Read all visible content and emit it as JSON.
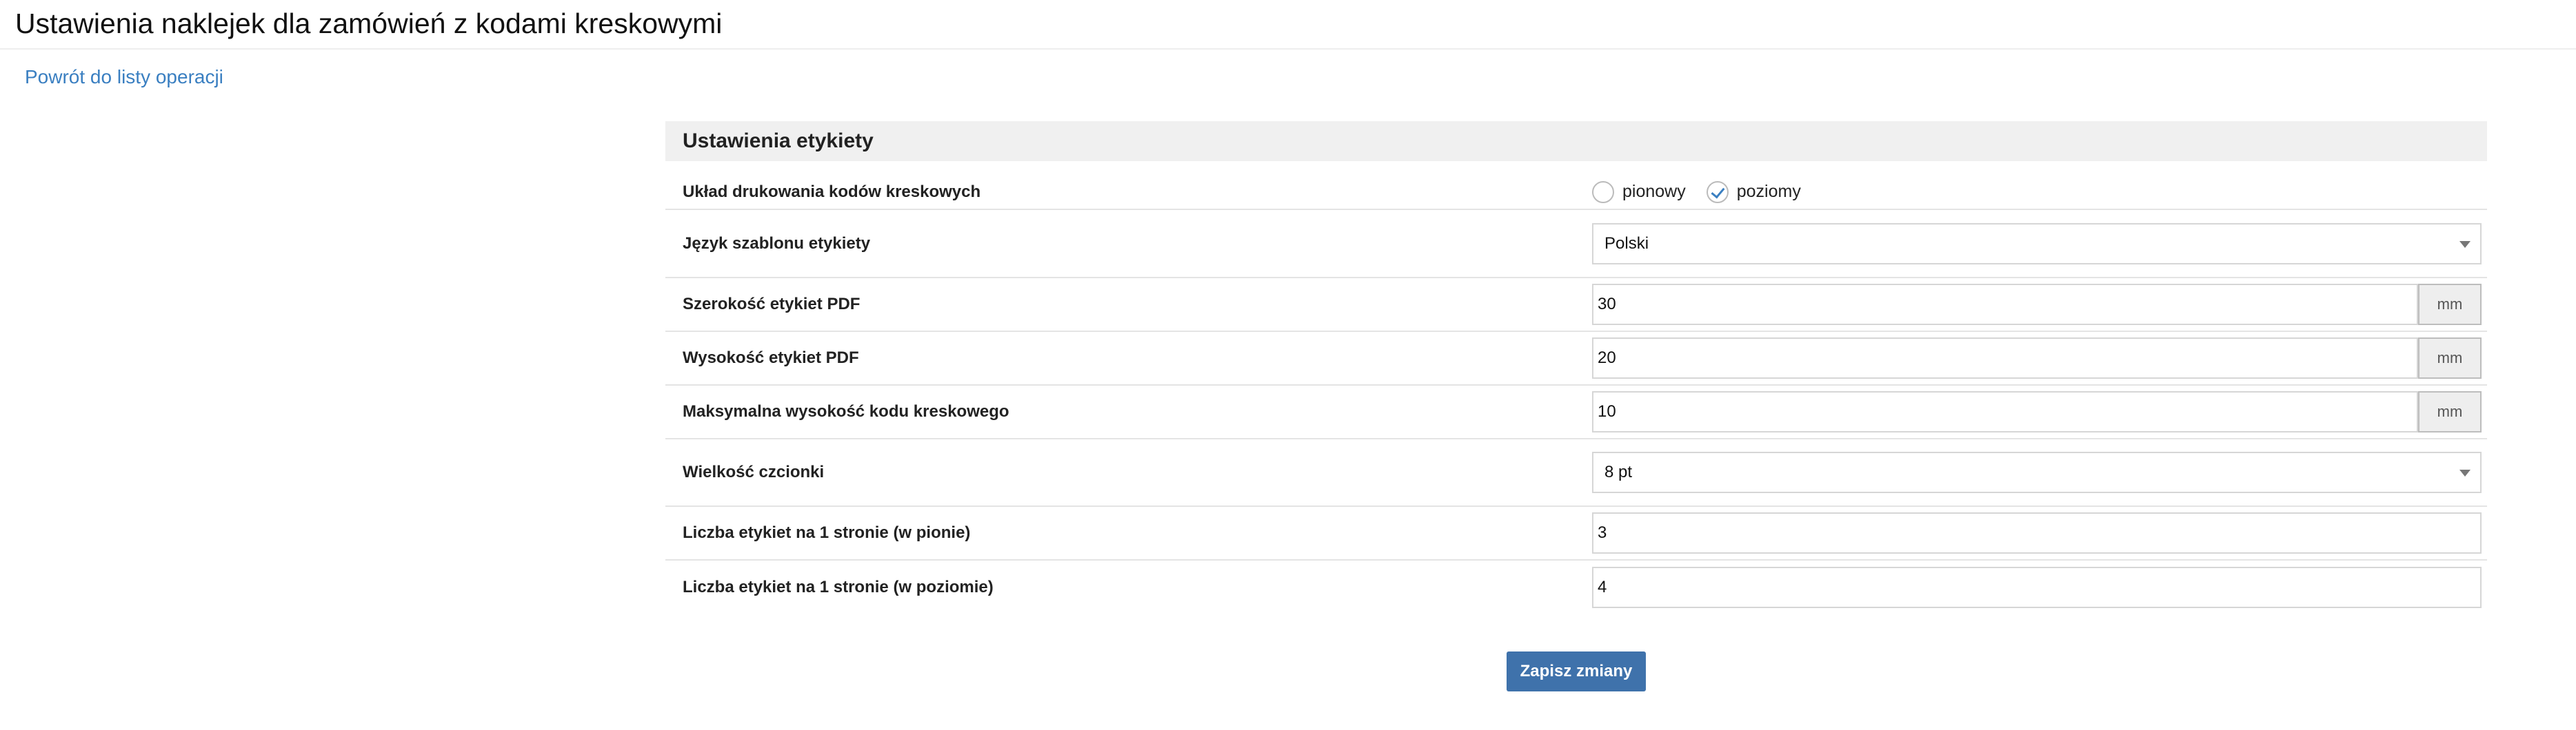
{
  "page": {
    "title": "Ustawienia naklejek dla zamówień z kodami kreskowymi",
    "back_link": "Powrót do listy operacji"
  },
  "panel": {
    "heading": "Ustawienia etykiety"
  },
  "form": {
    "layout": {
      "label": "Układ drukowania kodów kreskowych",
      "options": [
        "pionowy",
        "poziomy"
      ],
      "selected": "poziomy"
    },
    "template_language": {
      "label": "Język szablonu etykiety",
      "value": "Polski"
    },
    "pdf_width": {
      "label": "Szerokość etykiet PDF",
      "value": "30",
      "unit": "mm"
    },
    "pdf_height": {
      "label": "Wysokość etykiet PDF",
      "value": "20",
      "unit": "mm"
    },
    "barcode_max_height": {
      "label": "Maksymalna wysokość kodu kreskowego",
      "value": "10",
      "unit": "mm"
    },
    "font_size": {
      "label": "Wielkość czcionki",
      "value": "8 pt"
    },
    "labels_vertical": {
      "label": "Liczba etykiet na 1 stronie (w pionie)",
      "value": "3"
    },
    "labels_horizontal": {
      "label": "Liczba etykiet na 1 stronie (w poziomie)",
      "value": "4"
    }
  },
  "actions": {
    "save_label": "Zapisz zmiany"
  },
  "colors": {
    "accent": "#3a7fc1",
    "button": "#3f72ab",
    "panel_heading_bg": "#f0f0f0"
  }
}
